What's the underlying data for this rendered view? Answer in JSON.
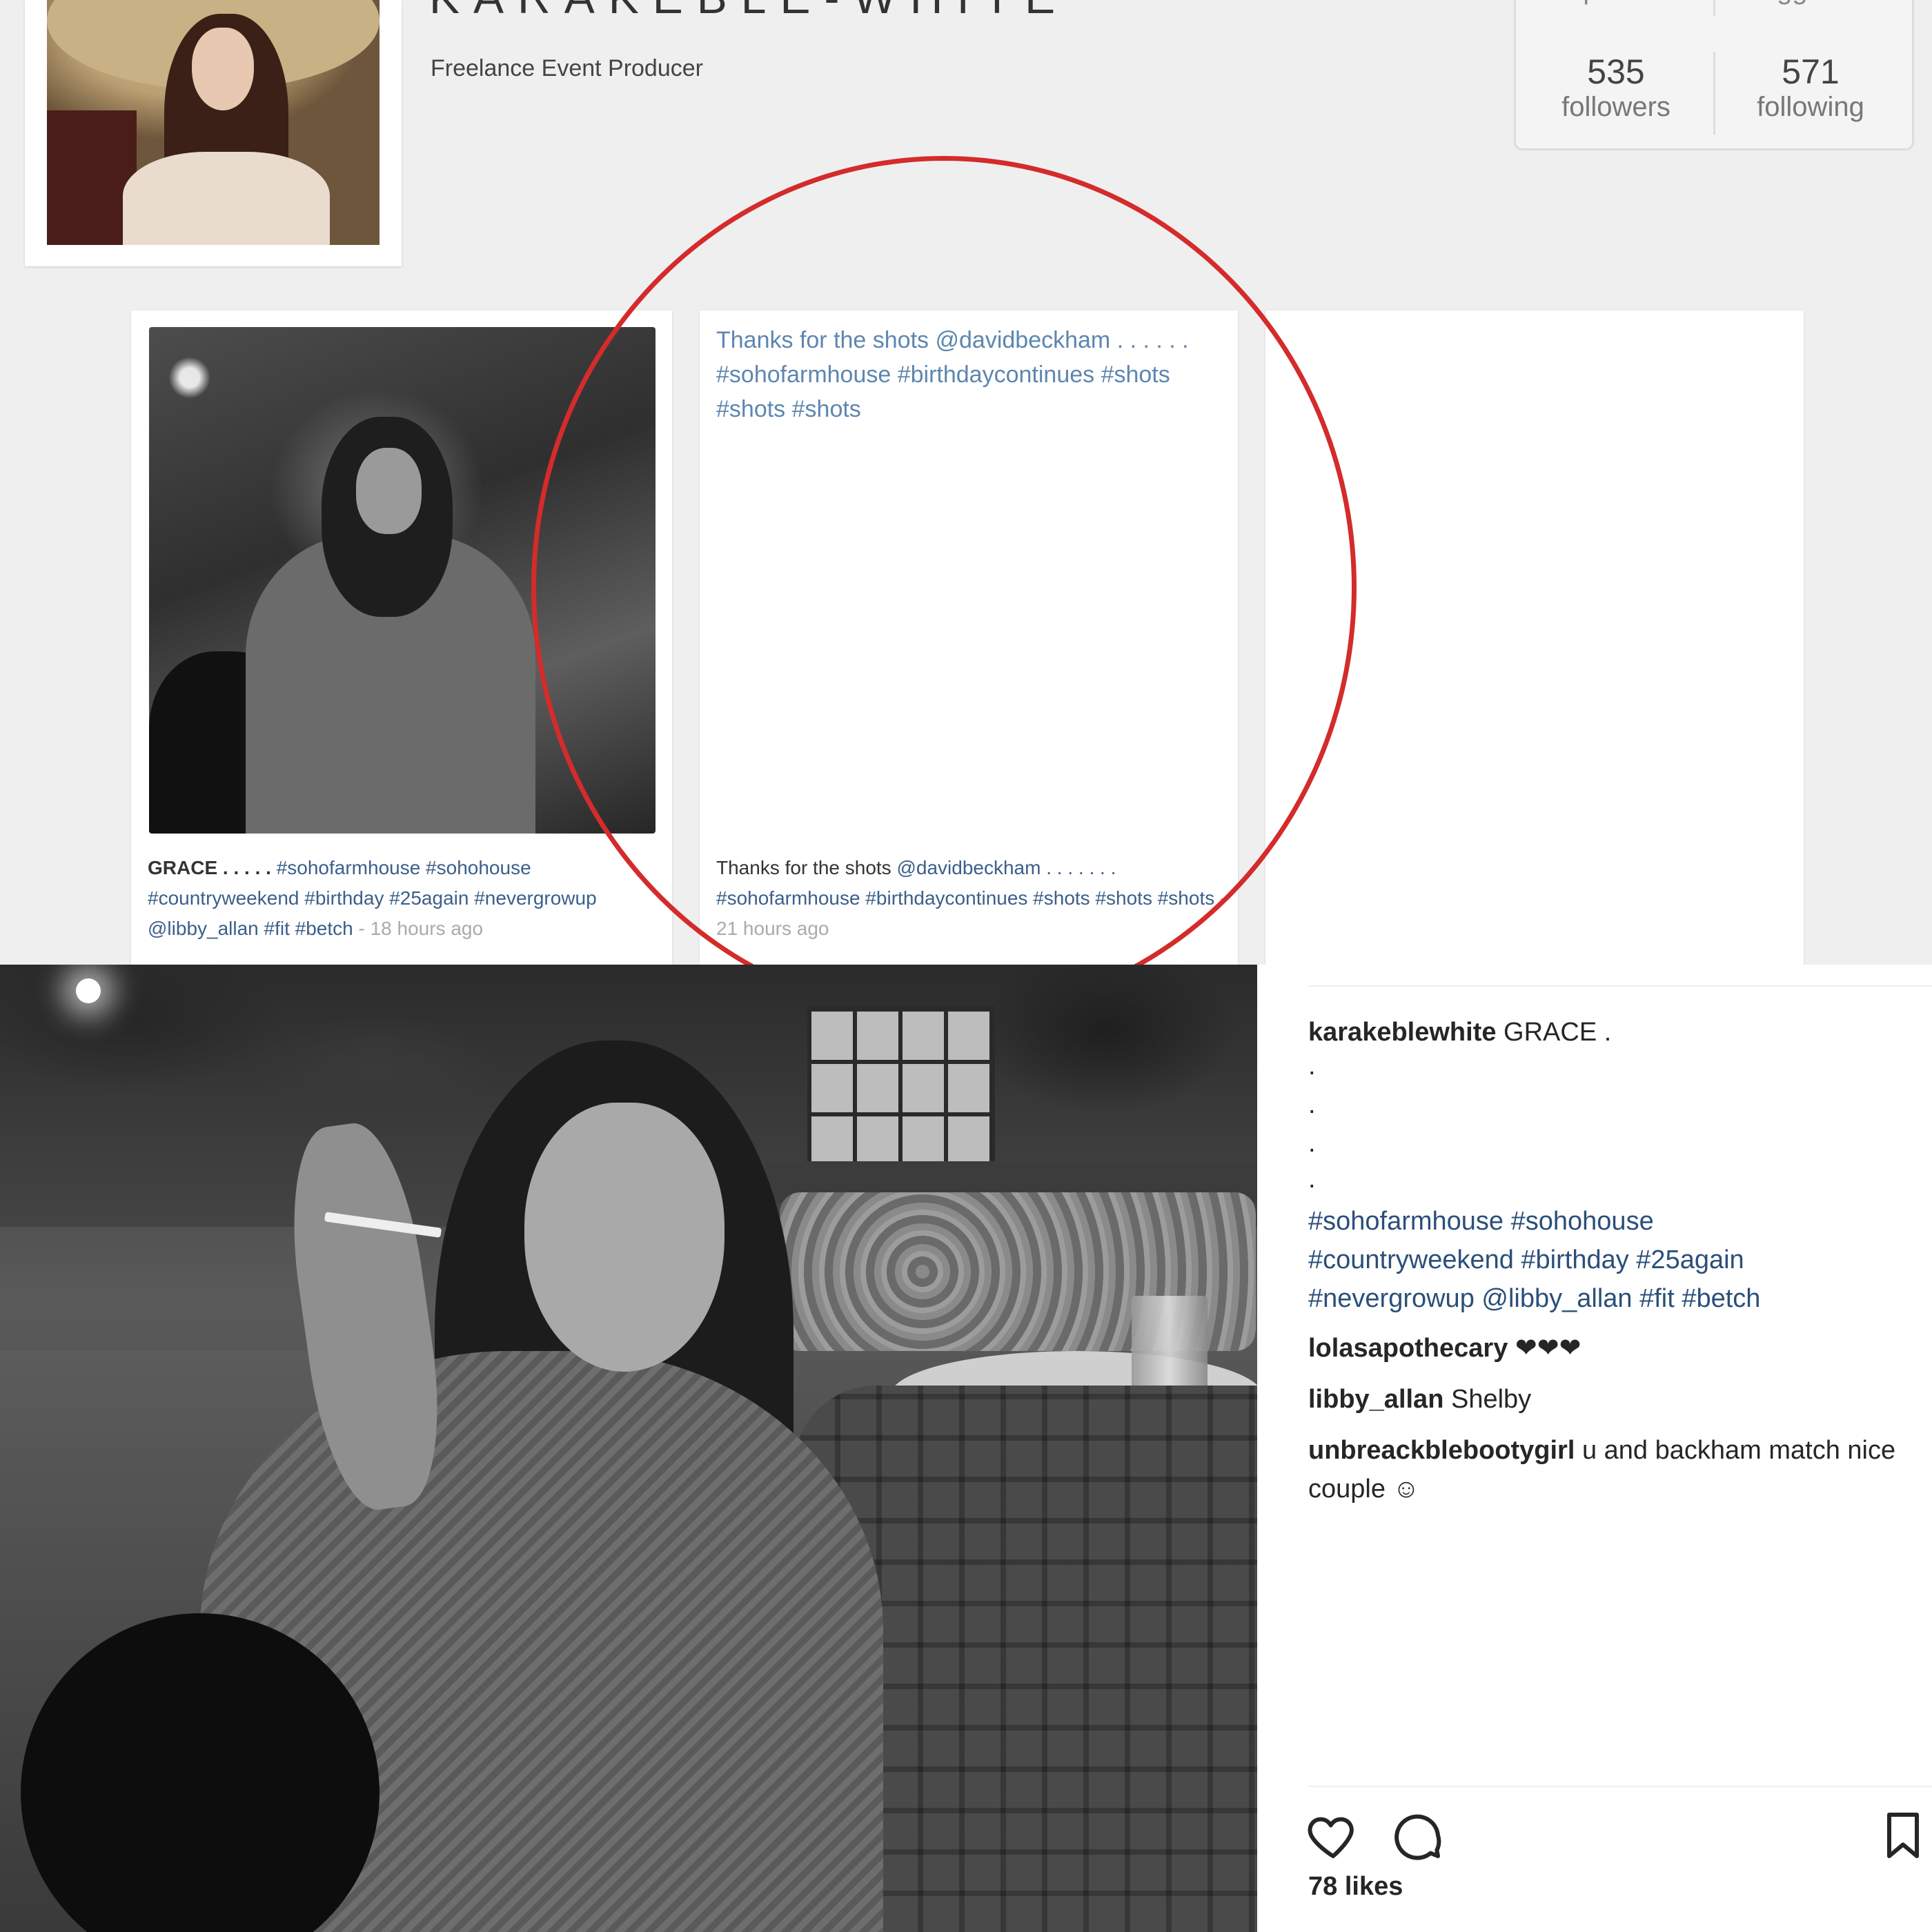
{
  "profile": {
    "name": "KARAKEBLE-WHITE",
    "role": "Freelance Event Producer",
    "stats": {
      "posts_label": "posts",
      "tagged_label": "tagged in",
      "followers_count": "535",
      "followers_label": "followers",
      "following_count": "571",
      "following_label": "following"
    }
  },
  "cards": [
    {
      "caption_lead": "GRACE . . . . .",
      "caption_tags": "#sohofarmhouse #sohohouse #countryweekend #birthday #25again #nevergrowup @libby_allan #fit #betch",
      "time": " - 18 hours ago"
    },
    {
      "text": "Thanks for the shots @davidbeckham . . . . . . #sohofarmhouse #birthdaycontinues #shots #shots #shots",
      "caption_lead": "Thanks for the shots",
      "caption_tags": "@davidbeckham . . . . . . . #sohofarmhouse #birthdaycontinues #shots #shots #shots",
      "time": " - 21 hours ago"
    }
  ],
  "post": {
    "author": "karakeblewhite",
    "caption": "GRACE .",
    "dots": [
      ".",
      ".",
      ".",
      "."
    ],
    "hashtags": "#sohofarmhouse #sohohouse #countryweekend #birthday #25again #nevergrowup @libby_allan #fit #betch",
    "comments": [
      {
        "user": "lolasapothecary",
        "text": "❤❤❤"
      },
      {
        "user": "libby_allan",
        "text": "Shelby"
      },
      {
        "user": "unbreackblebootygirl",
        "text": "u and backham match nice couple ☺"
      }
    ],
    "likes": "78 likes"
  },
  "icons": {
    "like": "heart-icon",
    "comment": "comment-icon",
    "save": "bookmark-icon"
  },
  "colors": {
    "highlight_circle": "#d42b2b",
    "link": "#2b4f7a"
  }
}
